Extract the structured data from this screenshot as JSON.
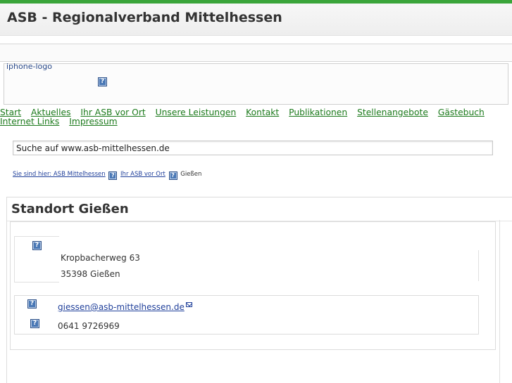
{
  "header": {
    "site_title": "ASB - Regionalverband Mittelhessen"
  },
  "logo": {
    "alt_text": "iphone-logo"
  },
  "nav": {
    "items": [
      "Start",
      "Aktuelles",
      "Ihr ASB vor Ort",
      "Unsere Leistungen",
      "Kontakt",
      "Publikationen",
      "Stellenangebote",
      "Gästebuch",
      "Internet Links",
      "Impressum"
    ]
  },
  "search": {
    "value": "Suche auf www.asb-mittelhessen.de"
  },
  "breadcrumb": {
    "prefix_link": "Sie sind hier: ASB Mittelhessen",
    "link2": "Ihr ASB vor Ort",
    "current": "Gießen"
  },
  "main": {
    "title": "Standort Gießen",
    "address": {
      "street": "Kropbacherweg 63",
      "city": "35398 Gießen"
    },
    "contact": {
      "email": "giessen@asb-mittelhessen.de",
      "phone": "0641 9726969"
    }
  },
  "colors": {
    "accent_green": "#3aa53a",
    "nav_link": "#1c7a1c",
    "link_blue": "#1f3f9a"
  }
}
